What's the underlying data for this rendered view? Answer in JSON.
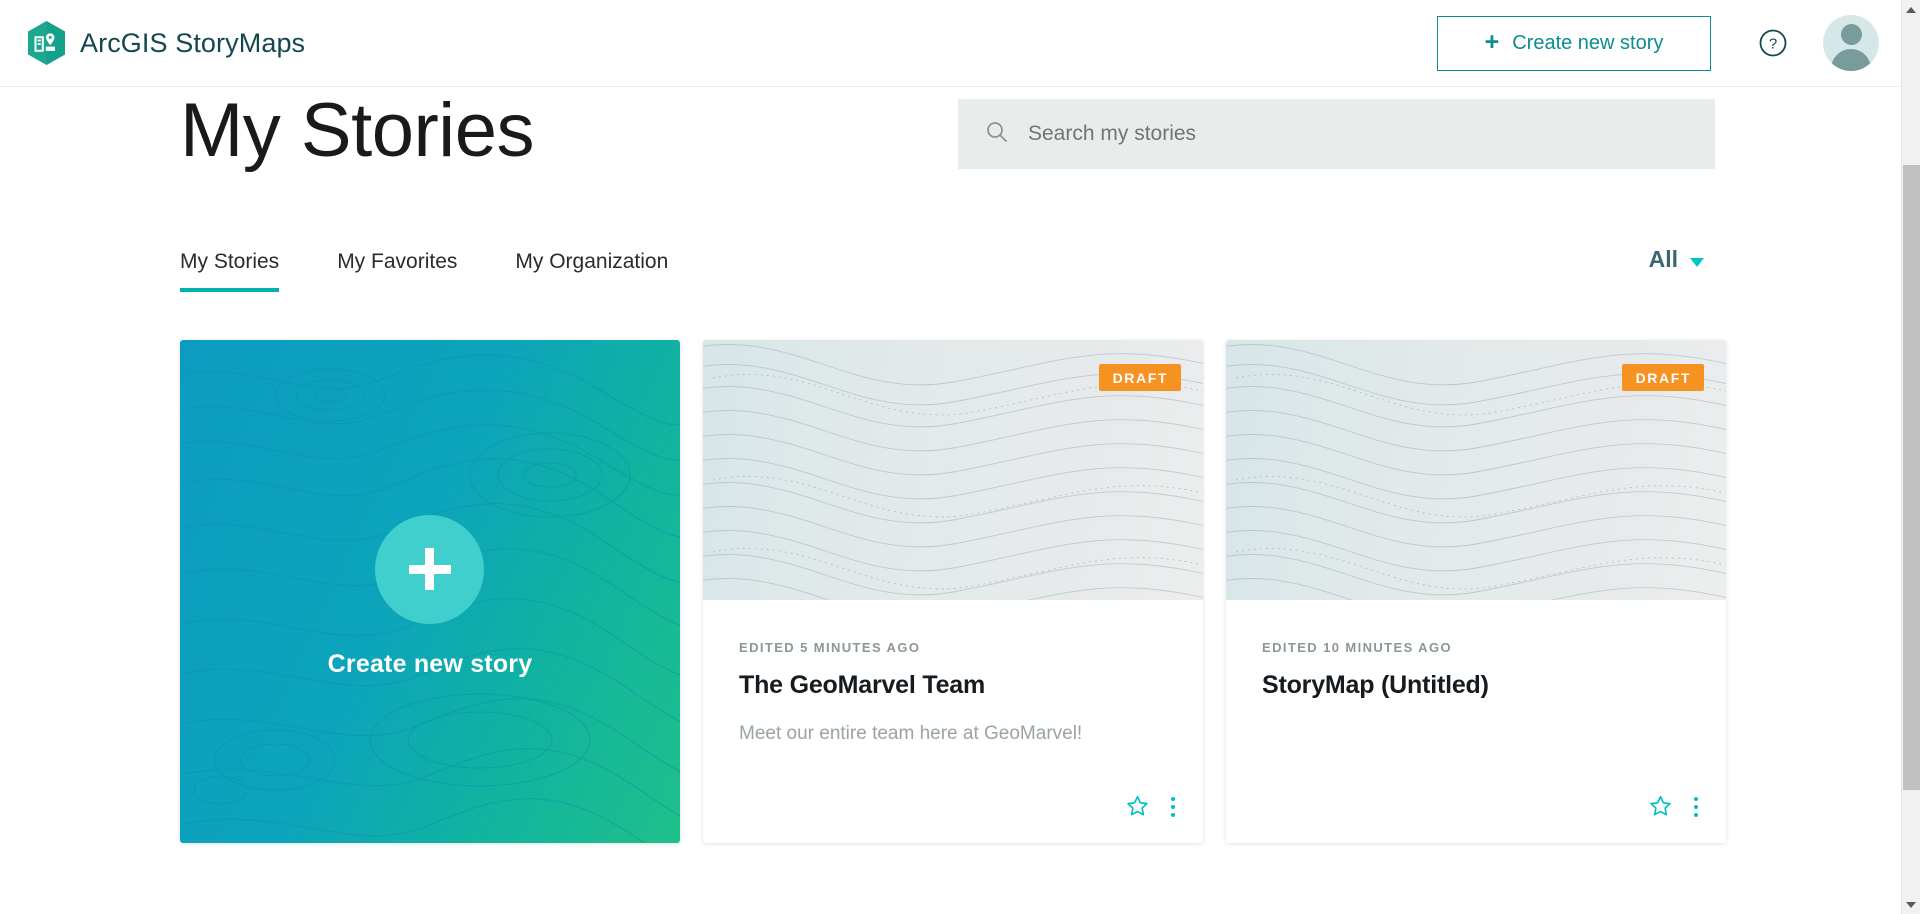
{
  "app": {
    "brand_title": "ArcGIS StoryMaps",
    "logo_icon": "storymaps-logo-icon",
    "accent_teal": "#0d8c91",
    "accent_bright_teal": "#00c1c1",
    "draft_orange": "#f59222"
  },
  "header": {
    "create_button_label": "Create new story",
    "create_button_plus": "+",
    "help_icon": "help-question-icon",
    "avatar_icon": "user-avatar-icon"
  },
  "page": {
    "title": "My Stories"
  },
  "search": {
    "placeholder": "Search my stories",
    "value": "",
    "icon": "search-icon"
  },
  "tabs": [
    {
      "label": "My Stories",
      "active": true
    },
    {
      "label": "My Favorites",
      "active": false
    },
    {
      "label": "My Organization",
      "active": false
    }
  ],
  "filter": {
    "label": "All",
    "caret_icon": "chevron-down-icon"
  },
  "create_card": {
    "label": "Create new story",
    "plus_icon": "plus-icon"
  },
  "cards": [
    {
      "edited": "EDITED 5 MINUTES AGO",
      "title": "The GeoMarvel Team",
      "description": "Meet our entire team here at GeoMarvel!",
      "badge": "DRAFT",
      "favorite_icon": "star-outline-icon",
      "menu_icon": "kebab-menu-icon"
    },
    {
      "edited": "EDITED 10 MINUTES AGO",
      "title": "StoryMap (Untitled)",
      "description": "",
      "badge": "DRAFT",
      "favorite_icon": "star-outline-icon",
      "menu_icon": "kebab-menu-icon"
    }
  ],
  "scrollbar": {
    "up_arrow_icon": "scroll-up-arrow-icon",
    "down_arrow_icon": "scroll-down-arrow-icon"
  }
}
